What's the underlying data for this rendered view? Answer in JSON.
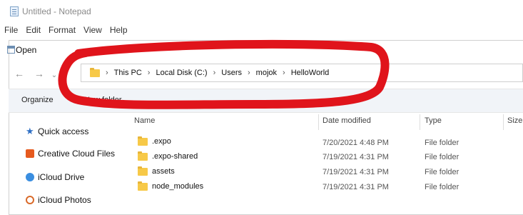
{
  "notepad": {
    "title": "Untitled - Notepad",
    "menu": [
      "File",
      "Edit",
      "Format",
      "View",
      "Help"
    ]
  },
  "dialog": {
    "title": "Open",
    "nav": {
      "back_icon": "arrow-left-icon",
      "forward_icon": "arrow-right-icon",
      "dropdown_icon": "chevron-down-icon"
    },
    "breadcrumb": [
      "This PC",
      "Local Disk (C:)",
      "Users",
      "mojok",
      "HelloWorld"
    ],
    "toolbar": {
      "organize": "Organize",
      "new_folder": "New folder"
    },
    "sidebar": [
      {
        "label": "Quick access",
        "icon": "star-icon"
      },
      {
        "label": "Creative Cloud Files",
        "icon": "creative-cloud-icon"
      },
      {
        "label": "iCloud Drive",
        "icon": "icloud-icon"
      },
      {
        "label": "iCloud Photos",
        "icon": "icloud-photos-icon"
      }
    ],
    "columns": {
      "name": "Name",
      "date": "Date modified",
      "type": "Type",
      "size": "Size"
    },
    "rows": [
      {
        "name": ".expo",
        "date": "7/20/2021 4:48 PM",
        "type": "File folder"
      },
      {
        "name": ".expo-shared",
        "date": "7/19/2021 4:31 PM",
        "type": "File folder"
      },
      {
        "name": "assets",
        "date": "7/19/2021 4:31 PM",
        "type": "File folder"
      },
      {
        "name": "node_modules",
        "date": "7/19/2021 4:31 PM",
        "type": "File folder"
      }
    ]
  },
  "colors": {
    "annotation": "#e0141b",
    "folder": "#f7c948",
    "toolbar_bg": "#f1f4f8"
  }
}
